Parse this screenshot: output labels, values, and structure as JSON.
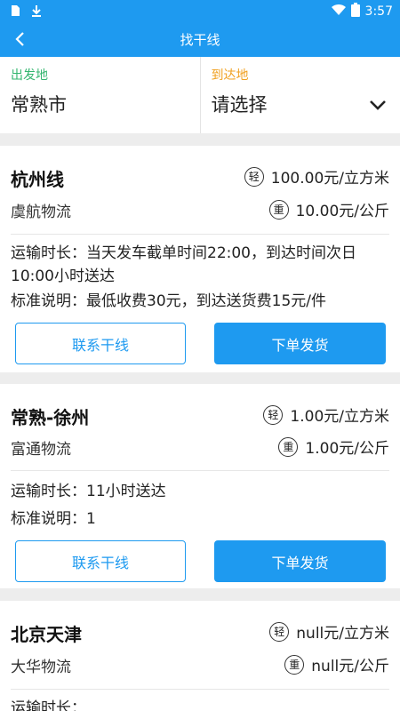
{
  "status_bar": {
    "time": "3:57",
    "icons": [
      "sim-card-icon",
      "download-icon",
      "wifi-icon",
      "battery-icon"
    ]
  },
  "app_bar": {
    "title": "找干线",
    "back_icon": "back-arrow-icon"
  },
  "route": {
    "origin_caption": "出发地",
    "origin_value": "常熟市",
    "dest_caption": "到达地",
    "dest_value": "请选择"
  },
  "colors": {
    "accent": "#1e9af0",
    "origin_caption": "#33b56f",
    "dest_caption": "#f0a020"
  },
  "lines": [
    {
      "name": "杭州线",
      "company": "虞航物流",
      "light_badge": "轻",
      "light_price": "100.00元/立方米",
      "heavy_badge": "重",
      "heavy_price": "10.00元/公斤",
      "transit": "运输时长：当天发车截单时间22:00，到达时间次日10:00小时送达",
      "standard": "标准说明：最低收费30元，到达送货费15元/件",
      "contact_label": "联系干线",
      "order_label": "下单发货"
    },
    {
      "name": "常熟-徐州",
      "company": "富通物流",
      "light_badge": "轻",
      "light_price": "1.00元/立方米",
      "heavy_badge": "重",
      "heavy_price": "1.00元/公斤",
      "transit": "运输时长：11小时送达",
      "standard": "标准说明：1",
      "contact_label": "联系干线",
      "order_label": "下单发货"
    },
    {
      "name": "北京天津",
      "company": "大华物流",
      "light_badge": "轻",
      "light_price": "null元/立方米",
      "heavy_badge": "重",
      "heavy_price": "null元/公斤",
      "transit": "运输时长：",
      "standard": "",
      "contact_label": "",
      "order_label": ""
    }
  ]
}
